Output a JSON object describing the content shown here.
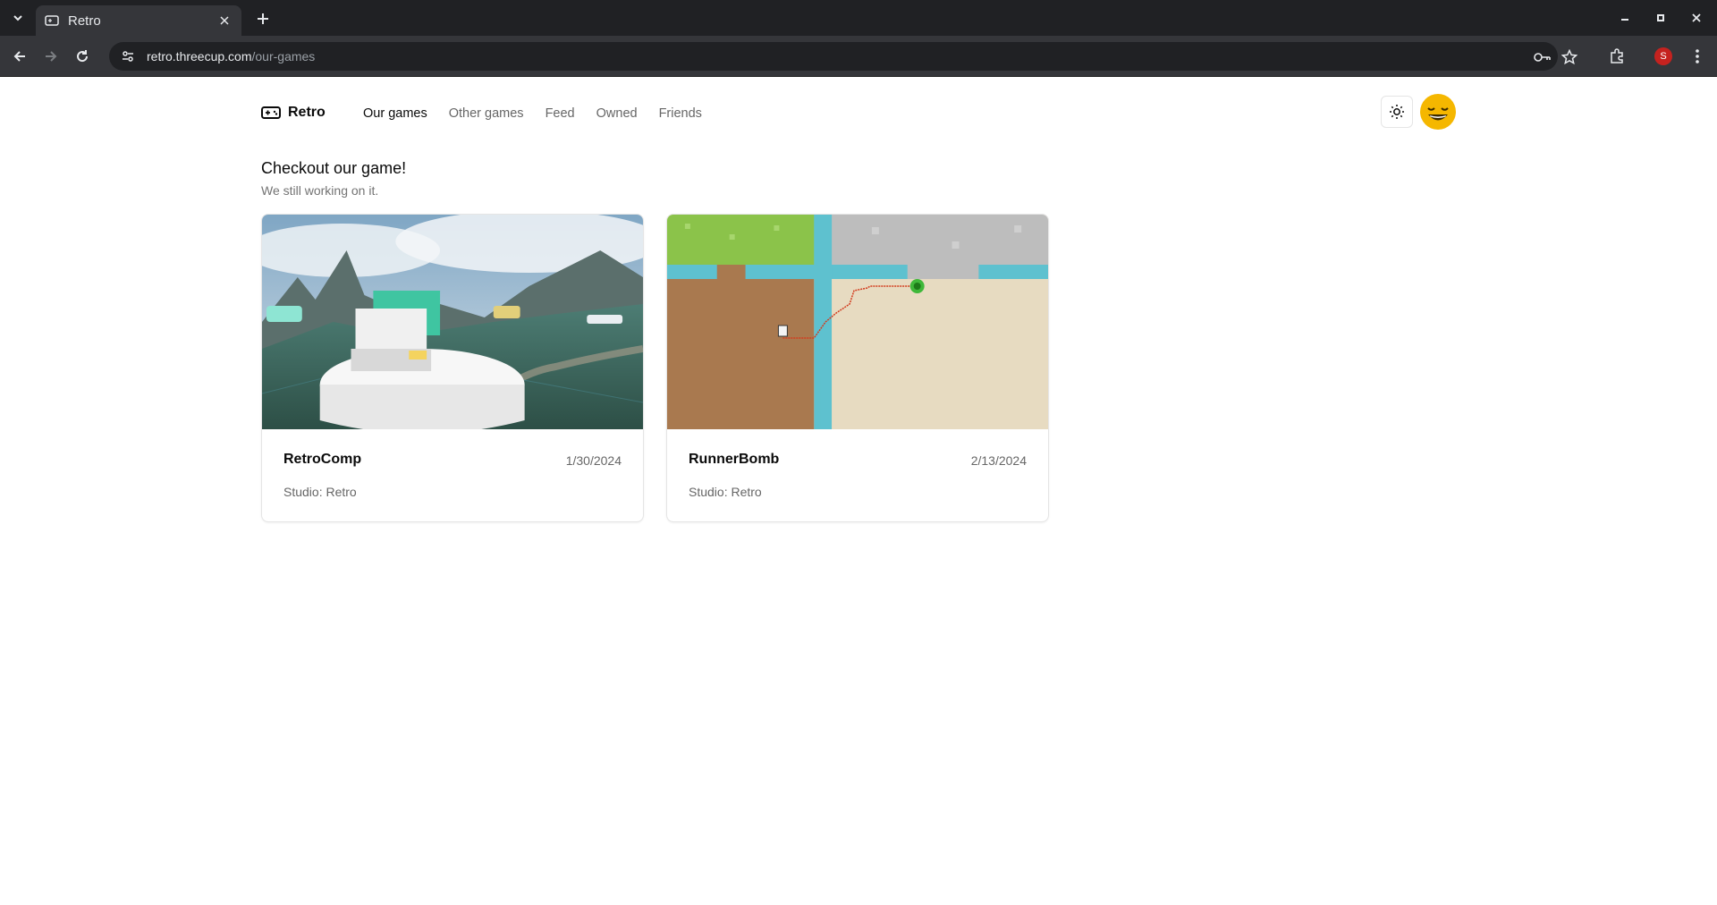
{
  "browser": {
    "tab_title": "Retro",
    "url_host": "retro.threecup.com",
    "url_path": "/our-games",
    "profile_initial": "S"
  },
  "site": {
    "logo_text": "Retro",
    "nav": [
      {
        "label": "Our games",
        "active": true
      },
      {
        "label": "Other games",
        "active": false
      },
      {
        "label": "Feed",
        "active": false
      },
      {
        "label": "Owned",
        "active": false
      },
      {
        "label": "Friends",
        "active": false
      }
    ]
  },
  "main": {
    "title": "Checkout our game!",
    "subtitle": "We still working on it.",
    "games": [
      {
        "title": "RetroComp",
        "date": "1/30/2024",
        "studio": "Studio: Retro",
        "image_icon": "3d-car-landscape-screenshot"
      },
      {
        "title": "RunnerBomb",
        "date": "2/13/2024",
        "studio": "Studio: Retro",
        "image_icon": "pixel-map-screenshot"
      }
    ]
  },
  "colors": {
    "chrome_dark": "#202124",
    "chrome_toolbar": "#35363a",
    "accent_avatar": "#f5b700",
    "profile_red": "#c5221f"
  }
}
